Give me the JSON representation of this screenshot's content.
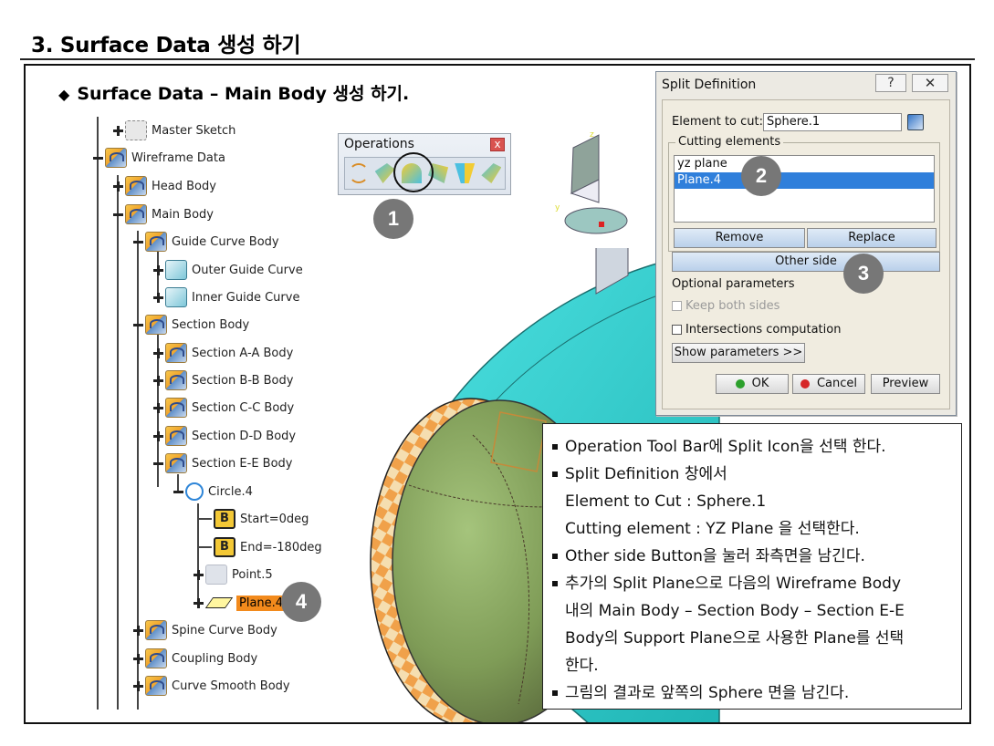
{
  "page": {
    "title": "3. Surface Data 생성 하기",
    "subtitle_bullet": "◆",
    "subtitle": "Surface Data – Main Body 생성 하기."
  },
  "tree": {
    "items": [
      {
        "label": "Master Sketch",
        "icon": "sketch-icon",
        "expanded": false
      },
      {
        "label": "Wireframe Data",
        "icon": "body-icon",
        "expanded": true
      },
      {
        "label": "Head Body",
        "icon": "body-icon",
        "expanded": false
      },
      {
        "label": "Main Body",
        "icon": "body-icon",
        "expanded": true
      },
      {
        "label": "Guide Curve Body",
        "icon": "body-icon",
        "expanded": true
      },
      {
        "label": "Outer Guide Curve",
        "icon": "curve-icon",
        "expanded": false
      },
      {
        "label": "Inner Guide Curve",
        "icon": "curve-icon",
        "expanded": false
      },
      {
        "label": "Section Body",
        "icon": "body-icon",
        "expanded": true
      },
      {
        "label": "Section A-A Body",
        "icon": "body-icon",
        "expanded": false
      },
      {
        "label": "Section B-B Body",
        "icon": "body-icon",
        "expanded": false
      },
      {
        "label": "Section C-C Body",
        "icon": "body-icon",
        "expanded": false
      },
      {
        "label": "Section D-D Body",
        "icon": "body-icon",
        "expanded": false
      },
      {
        "label": "Section E-E Body",
        "icon": "body-icon",
        "expanded": true
      },
      {
        "label": "Circle.4",
        "icon": "circle-icon",
        "expanded": true
      },
      {
        "label": "Start=0deg",
        "icon": "parameter-icon",
        "param_letter": "B"
      },
      {
        "label": "End=-180deg",
        "icon": "parameter-icon",
        "param_letter": "B"
      },
      {
        "label": "Point.5",
        "icon": "point-icon",
        "expanded": false
      },
      {
        "label": "Plane.4",
        "icon": "plane-icon",
        "expanded": false,
        "selected": true
      },
      {
        "label": "Spine Curve Body",
        "icon": "body-icon",
        "expanded": false
      },
      {
        "label": "Coupling Body",
        "icon": "body-icon",
        "expanded": false
      },
      {
        "label": "Curve Smooth Body",
        "icon": "body-icon",
        "expanded": false
      }
    ]
  },
  "operations_toolbar": {
    "title": "Operations",
    "close_label": "x",
    "tools": [
      "join-icon",
      "split-icon",
      "trim-icon",
      "boundary-icon",
      "extract-icon",
      "shape-fillet-icon"
    ]
  },
  "badges": {
    "b1": "1",
    "b2": "2",
    "b3": "3",
    "b4": "4"
  },
  "split_dialog": {
    "title": "Split Definition",
    "help_label": "?",
    "close_label": "✕",
    "element_to_cut_label": "Element to cut:",
    "element_to_cut_value": "Sphere.1",
    "cutting_elements_label": "Cutting elements",
    "cutting_elements": [
      "yz plane",
      "Plane.4"
    ],
    "selected_index": 1,
    "remove_label": "Remove",
    "replace_label": "Replace",
    "other_side_label": "Other side",
    "optional_parameters_label": "Optional parameters",
    "keep_both_sides_label": "Keep both sides",
    "intersections_label": "Intersections computation",
    "show_parameters_label": "Show parameters >>",
    "ok_label": "OK",
    "cancel_label": "Cancel",
    "preview_label": "Preview",
    "colors": {
      "ok_dot": "#2ca02c",
      "cancel_dot": "#d62728",
      "selection": "#2f7fdb"
    }
  },
  "notes": [
    {
      "text": "Operation Tool Bar에 Split Icon을 선택 한다.",
      "bullet": true
    },
    {
      "text": "Split Definition 창에서",
      "bullet": true
    },
    {
      "text": "Element to Cut : Sphere.1",
      "bullet": false
    },
    {
      "text": "Cutting element : YZ Plane 을 선택한다.",
      "bullet": false
    },
    {
      "text": "Other side Button을 눌러 좌측면을 남긴다.",
      "bullet": true
    },
    {
      "text": "추가의 Split Plane으로 다음의 Wireframe Body",
      "bullet": true
    },
    {
      "text": "내의 Main Body – Section Body – Section E-E",
      "bullet": false
    },
    {
      "text": "Body의 Support Plane으로 사용한 Plane를 선택",
      "bullet": false
    },
    {
      "text": "한다.",
      "bullet": false
    },
    {
      "text": "그림의 결과로 앞쪽의 Sphere 면을 남긴다.",
      "bullet": true
    }
  ],
  "colors": {
    "accent_cyan": "#2fd1d1",
    "sphere_green": "#7aa05a",
    "pattern_orange": "#f2a24a"
  }
}
